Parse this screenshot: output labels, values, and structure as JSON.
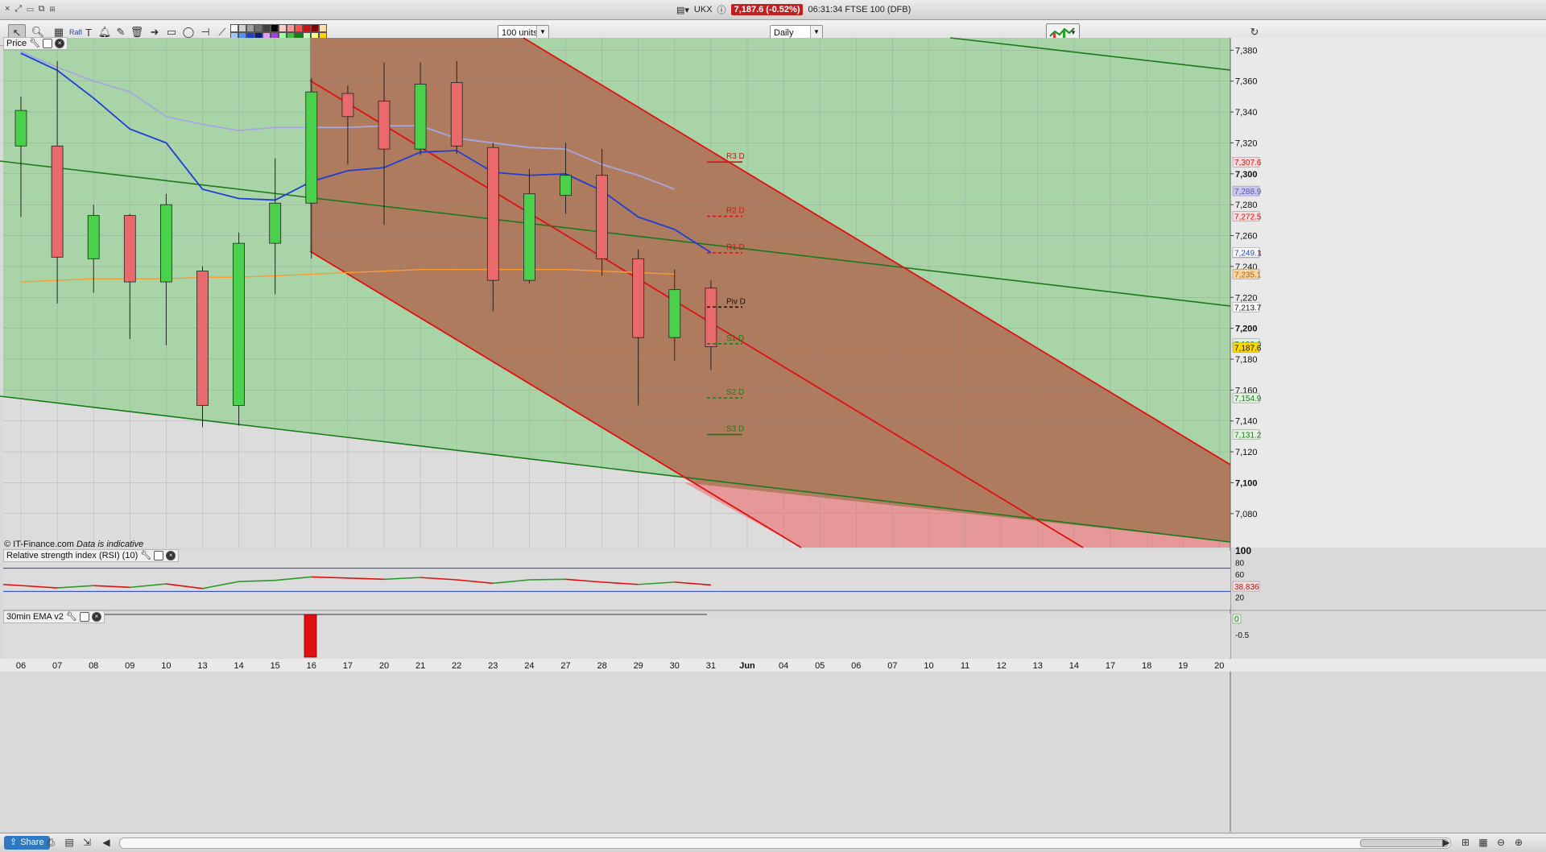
{
  "window": {
    "symbol": "UKX",
    "price_chip": "7,187.6 (-0.52%)",
    "clock_desc": "06:31:34 FTSE 100 (DFB)"
  },
  "toolbar": {
    "units_select": "100 units",
    "period_select": "Daily",
    "fib_label": "Rafl"
  },
  "panels": {
    "price_label": "Price",
    "rsi_label": "Relative strength index (RSI) (10)",
    "ema_label": "30min EMA v2",
    "copyright": "© IT-Finance.com",
    "disclaimer": "Data is indicative"
  },
  "colors": {
    "bull_fill": "#4bd04b",
    "bear_fill": "#e86a6a",
    "channel_fill": "#b07358",
    "support_fill": "#9fd29f",
    "line_green": "#1a7a1a",
    "line_red": "#e01010",
    "ma_blue": "#1d3fd6",
    "ma_lavender": "#a6a6e0",
    "ma_orange": "#ff9a2e"
  },
  "chart_data": {
    "type": "candlestick",
    "ylim": [
      7058,
      7388
    ],
    "y_ticks": [
      {
        "v": 7380,
        "label": "7,380"
      },
      {
        "v": 7360,
        "label": "7,360"
      },
      {
        "v": 7340,
        "label": "7,340"
      },
      {
        "v": 7320,
        "label": "7,320"
      },
      {
        "v": 7300,
        "label": "7,300",
        "bold": true
      },
      {
        "v": 7280,
        "label": "7,280"
      },
      {
        "v": 7260,
        "label": "7,260"
      },
      {
        "v": 7240,
        "label": "7,240"
      },
      {
        "v": 7220,
        "label": "7,220"
      },
      {
        "v": 7200,
        "label": "7,200",
        "bold": true
      },
      {
        "v": 7180,
        "label": "7,180"
      },
      {
        "v": 7160,
        "label": "7,160"
      },
      {
        "v": 7140,
        "label": "7,140"
      },
      {
        "v": 7120,
        "label": "7,120"
      },
      {
        "v": 7100,
        "label": "7,100",
        "bold": true
      },
      {
        "v": 7080,
        "label": "7,080"
      }
    ],
    "x_labels": [
      "06",
      "07",
      "08",
      "09",
      "10",
      "13",
      "14",
      "15",
      "16",
      "17",
      "20",
      "21",
      "22",
      "23",
      "24",
      "27",
      "28",
      "29",
      "30",
      "31",
      "Jun",
      "04",
      "05",
      "06",
      "07",
      "10",
      "11",
      "12",
      "13",
      "14",
      "17",
      "18",
      "19",
      "20"
    ],
    "candles": [
      {
        "d": "06",
        "o": 7318,
        "h": 7350,
        "l": 7272,
        "c": 7341
      },
      {
        "d": "07",
        "o": 7318,
        "h": 7373,
        "l": 7216,
        "c": 7246
      },
      {
        "d": "08",
        "o": 7245,
        "h": 7280,
        "l": 7223,
        "c": 7273
      },
      {
        "d": "09",
        "o": 7273,
        "h": 7274,
        "l": 7193,
        "c": 7230
      },
      {
        "d": "10",
        "o": 7230,
        "h": 7287,
        "l": 7189,
        "c": 7280
      },
      {
        "d": "13",
        "o": 7237,
        "h": 7240,
        "l": 7136,
        "c": 7150
      },
      {
        "d": "14",
        "o": 7150,
        "h": 7262,
        "l": 7137,
        "c": 7255
      },
      {
        "d": "15",
        "o": 7255,
        "h": 7310,
        "l": 7222,
        "c": 7281
      },
      {
        "d": "16",
        "o": 7281,
        "h": 7362,
        "l": 7245,
        "c": 7353
      },
      {
        "d": "17",
        "o": 7352,
        "h": 7357,
        "l": 7306,
        "c": 7337
      },
      {
        "d": "20",
        "o": 7347,
        "h": 7372,
        "l": 7267,
        "c": 7316
      },
      {
        "d": "21",
        "o": 7316,
        "h": 7372,
        "l": 7312,
        "c": 7358
      },
      {
        "d": "22",
        "o": 7359,
        "h": 7373,
        "l": 7313,
        "c": 7318
      },
      {
        "d": "23",
        "o": 7317,
        "h": 7320,
        "l": 7211,
        "c": 7231
      },
      {
        "d": "24",
        "o": 7231,
        "h": 7303,
        "l": 7229,
        "c": 7287
      },
      {
        "d": "27",
        "o": 7286,
        "h": 7320,
        "l": 7274,
        "c": 7299
      },
      {
        "d": "28",
        "o": 7299,
        "h": 7316,
        "l": 7234,
        "c": 7245
      },
      {
        "d": "29",
        "o": 7245,
        "h": 7251,
        "l": 7150,
        "c": 7194
      },
      {
        "d": "30",
        "o": 7194,
        "h": 7238,
        "l": 7179,
        "c": 7225
      },
      {
        "d": "31",
        "o": 7226,
        "h": 7231,
        "l": 7173,
        "c": 7188
      }
    ],
    "ma_blue": [
      7378,
      7367,
      7349,
      7329,
      7320,
      7290,
      7284,
      7283,
      7295,
      7302,
      7304,
      7314,
      7315,
      7301,
      7299,
      7300,
      7289,
      7272,
      7264,
      7249
    ],
    "ma_lavender": [
      7379,
      7369,
      7360,
      7353,
      7337,
      7332,
      7328,
      7330,
      7330,
      7330,
      7331,
      7331,
      7323,
      7320,
      7317,
      7316,
      7306,
      7299,
      7290
    ],
    "ma_orange": [
      7230,
      7231,
      7232,
      7232,
      7232,
      7233,
      7233,
      7234,
      7235,
      7236,
      7237,
      7238,
      7238,
      7238,
      7238,
      7238,
      7237,
      7236,
      7235
    ],
    "pivots": [
      {
        "label": "R3 D",
        "value": 7307.6,
        "tag": "7,307.6",
        "color": "#e01010",
        "style": "solid"
      },
      {
        "label": "R2 D",
        "value": 7272.5,
        "tag": "7,272.5",
        "color": "#e01010",
        "style": "dashed"
      },
      {
        "label": "R1 D",
        "value": 7248.8,
        "tag": "7,248.8",
        "color": "#e01010",
        "style": "dashed"
      },
      {
        "label": "Piv D",
        "value": 7213.7,
        "tag": "7,213.7",
        "color": "#111111",
        "style": "dashed"
      },
      {
        "label": "S1 D",
        "value": 7190.0,
        "tag": "7,190.0",
        "color": "#1a7a1a",
        "style": "dashed"
      },
      {
        "label": "S2 D",
        "value": 7154.9,
        "tag": "7,154.9",
        "color": "#1a7a1a",
        "style": "dashed"
      },
      {
        "label": "S3 D",
        "value": 7131.2,
        "tag": "7,131.2",
        "color": "#1a7a1a",
        "style": "solid"
      }
    ],
    "price_tags": [
      {
        "v": 7288.9,
        "tag": "7,288.9",
        "bg": "#c8c8ee",
        "fg": "#5a5ab0"
      },
      {
        "v": 7249.1,
        "tag": "7,249.1",
        "bg": "#ffffff",
        "fg": "#1d3fd6"
      },
      {
        "v": 7235.1,
        "tag": "7,235.1",
        "bg": "#ffd6a0",
        "fg": "#b26010"
      },
      {
        "v": 7187.6,
        "tag": "7,187.6",
        "bg": "#ffd800",
        "fg": "#111111"
      }
    ],
    "rsi": {
      "ticks": [
        {
          "v": 100,
          "label": "100"
        },
        {
          "v": 80,
          "label": "80"
        },
        {
          "v": 60,
          "label": "60"
        },
        {
          "v": 40,
          "label": "40"
        },
        {
          "v": 20,
          "label": "20"
        }
      ],
      "value_tag": "38.836",
      "values": [
        42,
        36,
        40,
        37,
        43,
        35,
        47,
        49,
        55,
        53,
        51,
        54,
        50,
        44,
        50,
        51,
        46,
        42,
        46,
        41
      ]
    },
    "ema": {
      "ticks": [
        {
          "v": 0,
          "label": "0"
        },
        {
          "v": -0.5,
          "label": "-0.5"
        }
      ],
      "zero_tag": "0"
    }
  }
}
